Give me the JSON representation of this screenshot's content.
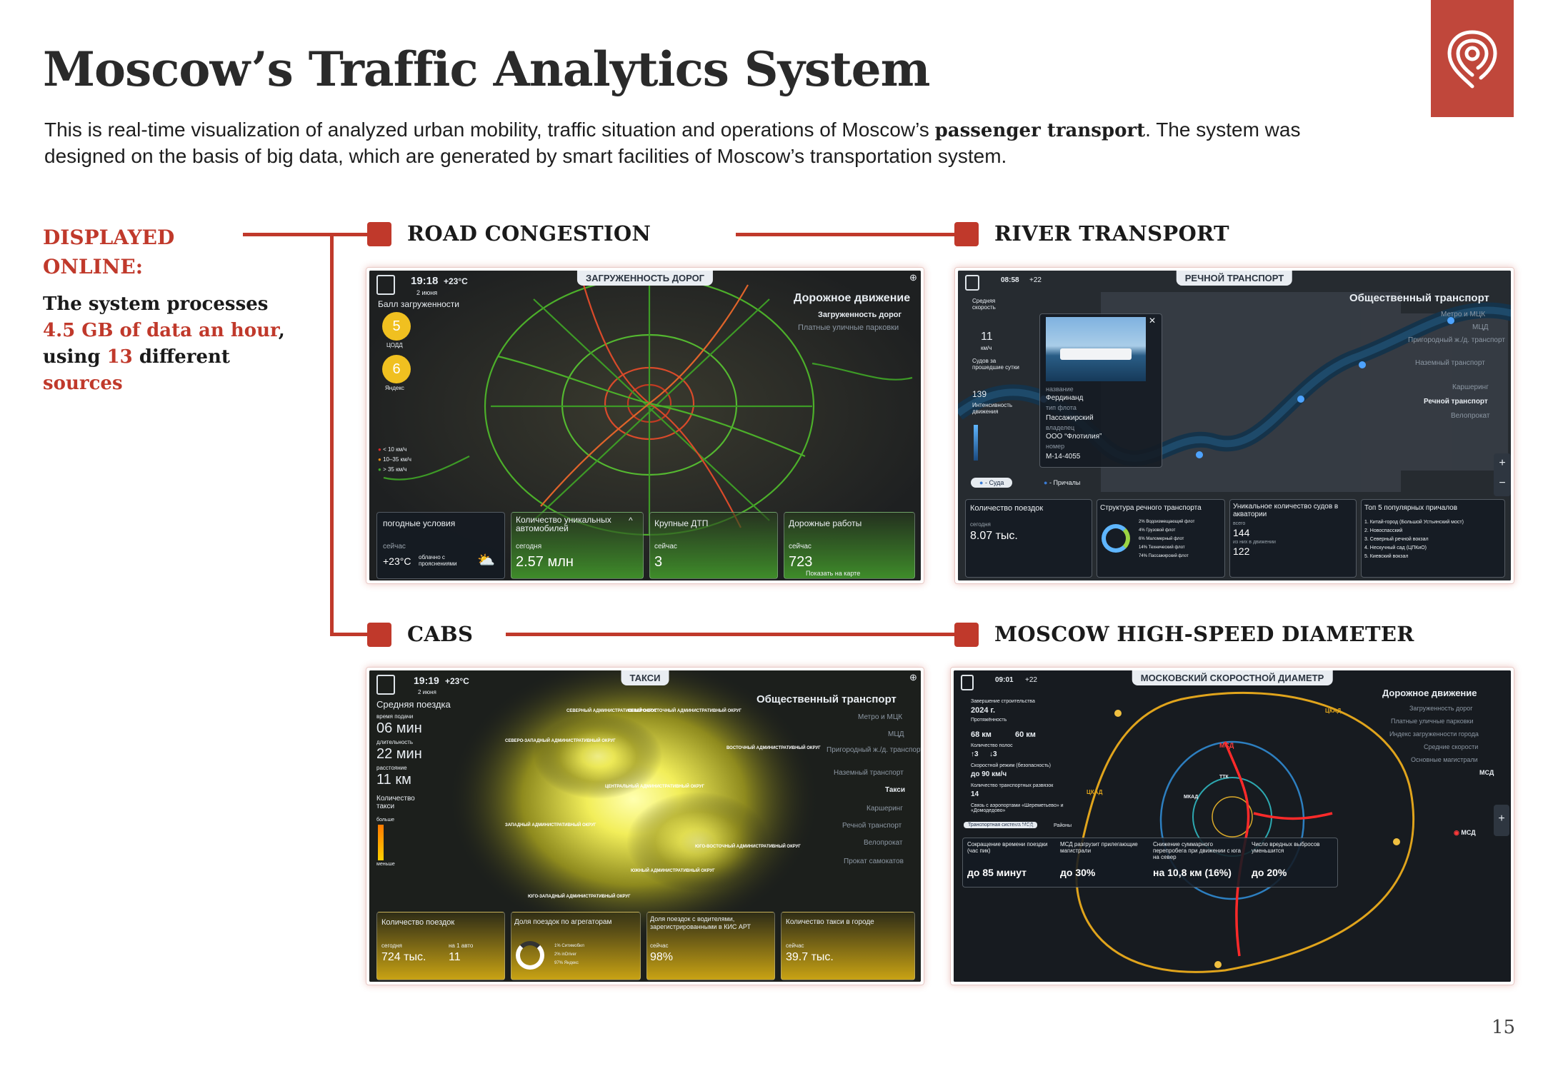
{
  "title": "Moscow’s Traffic Analytics System",
  "intro": {
    "before": "This is real-time visualization of analyzed urban mobility, traffic situation and operations of Moscow’s ",
    "bold": "passenger transport",
    "after": ". The system was designed on the basis of big data, which are generated by smart facilities of Moscow’s transportation system."
  },
  "sidebar": {
    "heading_line1": "DISPLAYED",
    "heading_line2": "ONLINE:",
    "text_1": "The system processes",
    "highlight_1": "4.5 GB of data an hour",
    "text_2": ",",
    "text_3": "using",
    "highlight_2": "13",
    "text_4": "different",
    "highlight_3": "sources"
  },
  "sections": {
    "road": "ROAD CONGESTION",
    "river": "RIVER TRANSPORT",
    "cabs": "CABS",
    "msd": "MOSCOW HIGH-SPEED DIAMETER"
  },
  "road_shot": {
    "tag": "ЗАГРУЖЕННОСТЬ ДОРОГ",
    "time": "19:18",
    "temp": "+23°C",
    "date": "2 июня",
    "score_label": "Балл загруженности",
    "score_1": "5",
    "score_1_src": "ЦОДД",
    "score_2": "6",
    "score_2_src": "Яндекс",
    "legend": [
      "< 10 км/ч",
      "10–35 км/ч",
      "> 35 км/ч"
    ],
    "menu_title": "Дорожное движение",
    "menu_1": "Загруженность дорог",
    "menu_2": "Платные уличные парковки",
    "p1_title": "погодные условия",
    "p1_sub": "сейчас",
    "p1_val": "+23°C",
    "p1_note": "облачно с прояснениями",
    "p2_title": "Количество уникальных автомобилей",
    "p2_sub": "сегодня",
    "p2_val": "2.57 млн",
    "p3_title": "Крупные ДТП",
    "p3_sub": "сейчас",
    "p3_val": "3",
    "p4_title": "Дорожные работы",
    "p4_sub": "сейчас",
    "p4_val": "723",
    "p4_note": "Показать на карте"
  },
  "river_shot": {
    "tag": "РЕЧНОЙ ТРАНСПОРТ",
    "time": "08:58",
    "temp": "+22",
    "speed_label": "Средняя скорость",
    "speed_val": "11",
    "speed_unit": "км/ч",
    "ships_label": "Судов за прошедшие сутки",
    "ships_val": "139",
    "intensity_label": "Интенсивность движения",
    "popup_name_label": "название",
    "popup_name": "Фердинанд",
    "popup_fleet_label": "тип флота",
    "popup_fleet": "Пассажирский",
    "popup_owner_label": "владелец",
    "popup_owner": "ООО “Флотилия”",
    "popup_num_label": "номер",
    "popup_num": "М-14-4055",
    "toggle_1": "Суда",
    "toggle_2": "Причалы",
    "menu_title": "Общественный транспорт",
    "menu_items": [
      "Метро и МЦК",
      "МЦД",
      "Пригородный ж./д. транспорт",
      "Наземный транспорт",
      "Каршеринг",
      "Речной транспорт",
      "Велопрокат"
    ],
    "p1_title": "Количество поездок",
    "p1_sub": "сегодня",
    "p1_val": "8.07 тыс.",
    "p2_title": "Структура речного транспорта",
    "p2_items": [
      "2% Водоизмещающий флот",
      "4% Грузовой флот",
      "6% Маломерный флот",
      "14% Технический флот",
      "74% Пассажирский флот"
    ],
    "p3_title": "Уникальное количество судов в акватории",
    "p3_sub_1": "всего",
    "p3_val_1": "144",
    "p3_sub_2": "из них в движении",
    "p3_val_2": "122",
    "p4_title": "Топ 5 популярных причалов",
    "p4_items": [
      "1. Китай-город (Большой Устьинский мост)",
      "2. Новоспасский",
      "3. Северный речной вокзал",
      "4. Нескучный сад (ЦПКиО)",
      "5. Киевский вокзал"
    ]
  },
  "cabs_shot": {
    "tag": "ТАКСИ",
    "time": "19:19",
    "temp": "+23°C",
    "date": "2 июня",
    "avg_label": "Средняя поездка",
    "wait_label": "время подачи",
    "wait_val": "06 мин",
    "dur_label": "длительность",
    "dur_val": "22 мин",
    "dist_label": "расстояние",
    "dist_val": "11 км",
    "count_label": "Количество такси",
    "more": "больше",
    "less": "меньше",
    "menu_title": "Общественный транспорт",
    "menu_items": [
      "Метро и МЦК",
      "МЦД",
      "Пригородный ж./д. транспорт",
      "Наземный транспорт",
      "Такси",
      "Каршеринг",
      "Речной транспорт",
      "Велопрокат",
      "Прокат самокатов"
    ],
    "districts": [
      "СЕВЕРНЫЙ АДМИНИСТРАТИВНЫЙ ОКРУГ",
      "СЕВЕРО-ВОСТОЧНЫЙ АДМИНИСТРАТИВНЫЙ ОКРУГ",
      "СЕВЕРО-ЗАПАДНЫЙ АДМИНИСТРАТИВНЫЙ ОКРУГ",
      "ВОСТОЧНЫЙ АДМИНИСТРАТИВНЫЙ ОКРУГ",
      "ЦЕНТРАЛЬНЫЙ АДМИНИСТРАТИВНЫЙ ОКРУГ",
      "ЗАПАДНЫЙ АДМИНИСТРАТИВНЫЙ ОКРУГ",
      "ЮГО-ВОСТОЧНЫЙ АДМИНИСТРАТИВНЫЙ ОКРУГ",
      "ЮЖНЫЙ АДМИНИСТРАТИВНЫЙ ОКРУГ",
      "ЮГО-ЗАПАДНЫЙ АДМИНИСТРАТИВНЫЙ ОКРУГ"
    ],
    "p1_title": "Количество поездок",
    "p1_sub_1": "сегодня",
    "p1_val_1": "724 тыс.",
    "p1_sub_2": "на 1 авто",
    "p1_val_2": "11",
    "p2_title": "Доля поездок по агрегаторам",
    "p2_items": [
      "1% Ситимобил",
      "2% inDriver",
      "97% Яндекс"
    ],
    "p3_title": "Доля поездок с водителями, зарегистрированными в КИС АРТ",
    "p3_sub": "сейчас",
    "p3_val": "98%",
    "p4_title": "Количество такси в городе",
    "p4_sub": "сейчас",
    "p4_val": "39.7 тыс."
  },
  "msd_shot": {
    "tag": "МОСКОВСКИЙ СКОРОСТНОЙ ДИАМЕТР",
    "time": "09:01",
    "temp": "+22",
    "done_label": "Завершение строительства",
    "done_val": "2024 г.",
    "len_label": "Протяжённость",
    "len_val_1": "68 км",
    "len_val_2": "60 км",
    "lanes_label": "Количество полос",
    "lanes_val_1": "↑3",
    "lanes_val_2": "↓3",
    "speed_label": "Скоростной режим (безопасность)",
    "speed_val": "до 90 км/ч",
    "junctions_label": "Количество транспортных развязок",
    "junctions_val": "14",
    "airports_label": "Связь с аэропортами «Шереметьево» и «Домодедово»",
    "tabs": [
      "Транспортная система МСД",
      "Развязки",
      "Районы"
    ],
    "map_labels": [
      "ЦКАД",
      "МКАД",
      "ТТК",
      "МСД",
      "ЦКАД"
    ],
    "menu_title": "Дорожное движение",
    "menu_items": [
      "Загруженность дорог",
      "Платные уличные парковки",
      "Индекс загруженности города",
      "Средние скорости",
      "Основные магистрали",
      "МСД"
    ],
    "legend": "МСД",
    "p1_title": "Сокращение времени поездки (час пик)",
    "p1_val": "до 85 минут",
    "p2_title": "МСД разгрузит прилегающие магистрали",
    "p2_val": "до 30%",
    "p3_title": "Снижение суммарного перепробега при движении с юга на север",
    "p3_val": "на 10,8 км (16%)",
    "p4_title": "Число вредных выбросов уменьшится",
    "p4_val": "до 20%"
  },
  "page_number": "15",
  "colors": {
    "accent": "#c0392b",
    "logo_bg": "#c0473b"
  },
  "icons": [
    "location-pin-logo-icon",
    "moscow-emblem-icon",
    "globe-icon",
    "plus-icon",
    "minus-icon",
    "close-icon"
  ]
}
